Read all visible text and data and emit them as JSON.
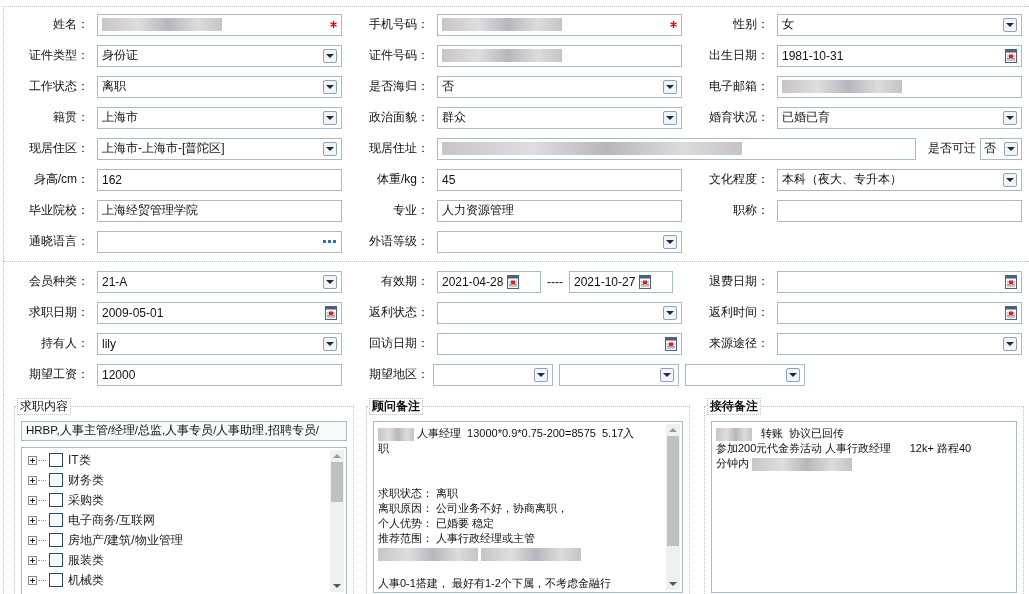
{
  "sections": [
    {
      "rows": [
        {
          "fields": [
            {
              "label": "姓名：",
              "kind": "text",
              "redacted": true,
              "required": true
            },
            {
              "label": "手机号码：",
              "kind": "text",
              "redacted": true,
              "required": true
            },
            {
              "label": "性别：",
              "kind": "select",
              "value": "女"
            }
          ]
        },
        {
          "fields": [
            {
              "label": "证件类型：",
              "kind": "select",
              "value": "身份证"
            },
            {
              "label": "证件号码：",
              "kind": "text",
              "redacted": true
            },
            {
              "label": "出生日期：",
              "kind": "date",
              "value": "1981-10-31"
            }
          ]
        },
        {
          "fields": [
            {
              "label": "工作状态：",
              "kind": "select",
              "value": "离职"
            },
            {
              "label": "是否海归：",
              "kind": "select",
              "value": "否"
            },
            {
              "label": "电子邮箱：",
              "kind": "text",
              "redacted": true
            }
          ]
        },
        {
          "fields": [
            {
              "label": "籍贯：",
              "kind": "select",
              "value": "上海市"
            },
            {
              "label": "政治面貌：",
              "kind": "select",
              "value": "群众"
            },
            {
              "label": "婚育状况：",
              "kind": "select",
              "value": "已婚已育"
            }
          ]
        },
        {
          "fields": [
            {
              "label": "现居住区：",
              "kind": "select",
              "value": "上海市-上海市-[普陀区]"
            },
            {
              "label": "现居住址：",
              "kind": "text",
              "redacted": true,
              "extra": {
                "label": "是否可迁",
                "value": "否"
              }
            }
          ]
        },
        {
          "fields": [
            {
              "label": "身高/cm：",
              "kind": "text",
              "value": "162"
            },
            {
              "label": "体重/kg：",
              "kind": "text",
              "value": "45"
            },
            {
              "label": "文化程度：",
              "kind": "select",
              "value": "本科（夜大、专升本）"
            }
          ]
        },
        {
          "fields": [
            {
              "label": "毕业院校：",
              "kind": "text",
              "value": "上海经贸管理学院"
            },
            {
              "label": "专业：",
              "kind": "text",
              "value": "人力资源管理"
            },
            {
              "label": "职称：",
              "kind": "text"
            }
          ]
        },
        {
          "fields": [
            {
              "label": "通晓语言：",
              "kind": "lookup"
            },
            {
              "label": "外语等级：",
              "kind": "select"
            }
          ]
        }
      ]
    },
    {
      "rows": [
        {
          "fields": [
            {
              "label": "会员种类：",
              "kind": "select",
              "value": "21-A"
            },
            {
              "label": "有效期：",
              "kind": "date_range",
              "from": "2021-04-28",
              "separator": "----",
              "to": "2021-10-27"
            },
            {
              "label": "退费日期：",
              "kind": "date"
            }
          ]
        },
        {
          "fields": [
            {
              "label": "求职日期：",
              "kind": "date",
              "value": "2009-05-01"
            },
            {
              "label": "返利状态：",
              "kind": "select"
            },
            {
              "label": "返利时间：",
              "kind": "date"
            }
          ]
        },
        {
          "fields": [
            {
              "label": "持有人：",
              "kind": "select",
              "value": "lily"
            },
            {
              "label": "回访日期：",
              "kind": "date"
            },
            {
              "label": "来源途径：",
              "kind": "select"
            }
          ]
        },
        {
          "fields": [
            {
              "label": "期望工资：",
              "kind": "text",
              "value": "12000"
            },
            {
              "label": "期望地区：",
              "kind": "multi_select",
              "dropdowns": [
                {
                  "kind": "select"
                },
                {
                  "kind": "select"
                },
                {
                  "kind": "select"
                }
              ]
            }
          ]
        }
      ]
    }
  ],
  "job_intent": {
    "legend": "求职内容",
    "value": "HRBP,人事主管/经理/总监,人事专员/人事助理,招聘专员/",
    "tree": [
      {
        "label": "IT类",
        "expanded": false,
        "checked": false
      },
      {
        "label": "财务类",
        "expanded": false,
        "checked": false
      },
      {
        "label": "采购类",
        "expanded": false,
        "checked": false
      },
      {
        "label": "电子商务/互联网",
        "expanded": false,
        "checked": false
      },
      {
        "label": "房地产/建筑/物业管理",
        "expanded": false,
        "checked": false
      },
      {
        "label": "服装类",
        "expanded": false,
        "checked": false
      },
      {
        "label": "机械类",
        "expanded": false,
        "checked": false
      }
    ]
  },
  "notes": [
    {
      "legend": "顾问备注",
      "scrollbar": true,
      "lines": [
        {
          "kind": "text",
          "parts": [
            {
              "kind": "blur_short"
            },
            {
              "kind": "text",
              "text": "人事经理  13000*0.9*0.75-200=8575  5.17入"
            }
          ]
        },
        {
          "kind": "text",
          "parts": [
            {
              "kind": "text",
              "text": "职"
            }
          ]
        },
        {
          "kind": "blank"
        },
        {
          "kind": "blank"
        },
        {
          "kind": "text",
          "parts": [
            {
              "kind": "text",
              "text": "求职状态： 离职"
            }
          ]
        },
        {
          "kind": "text",
          "parts": [
            {
              "kind": "text",
              "text": "离职原因： 公司业务不好，协商离职，"
            }
          ]
        },
        {
          "kind": "text",
          "parts": [
            {
              "kind": "text",
              "text": "个人优势： 已婚要 稳定"
            }
          ]
        },
        {
          "kind": "text",
          "parts": [
            {
              "kind": "text",
              "text": "推荐范围： 人事行政经理或主管"
            }
          ]
        },
        {
          "kind": "text",
          "parts": [
            {
              "kind": "blur_long"
            },
            {
              "kind": "blur_long"
            }
          ]
        },
        {
          "kind": "blank"
        },
        {
          "kind": "text",
          "parts": [
            {
              "kind": "text",
              "text": "人事0-1搭建， 最好有1-2个下属，不考虑金融行"
            }
          ]
        }
      ]
    },
    {
      "legend": "接待备注",
      "lines": [
        {
          "kind": "text",
          "parts": [
            {
              "kind": "blur_short"
            },
            {
              "kind": "text",
              "text": "  转账  协议已回传"
            }
          ]
        },
        {
          "kind": "text",
          "parts": [
            {
              "kind": "text",
              "text": "参加200元代金券活动 人事行政经理      12k+ 路程40"
            }
          ]
        },
        {
          "kind": "text",
          "parts": [
            {
              "kind": "text",
              "text": "分钟内 "
            },
            {
              "kind": "blur_long"
            }
          ]
        }
      ]
    }
  ]
}
